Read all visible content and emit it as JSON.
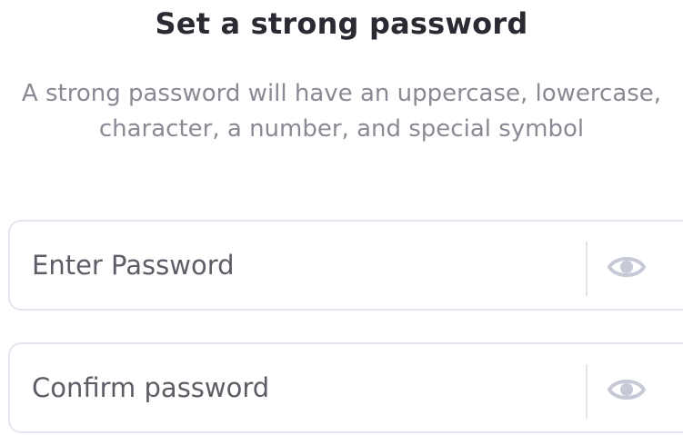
{
  "header": {
    "title": "Set a strong password",
    "subtitle": "A strong password will have an uppercase, lowercase, character, a number, and special symbol"
  },
  "form": {
    "password": {
      "placeholder": "Enter Password",
      "value": "",
      "toggle_icon": "eye-icon"
    },
    "confirm": {
      "placeholder": "Confirm password",
      "value": "",
      "toggle_icon": "eye-icon"
    }
  },
  "colors": {
    "title": "#2a2a33",
    "subtitle": "#8a8a94",
    "field_border": "#e4e6ef",
    "icon": "#c6c9d6"
  }
}
